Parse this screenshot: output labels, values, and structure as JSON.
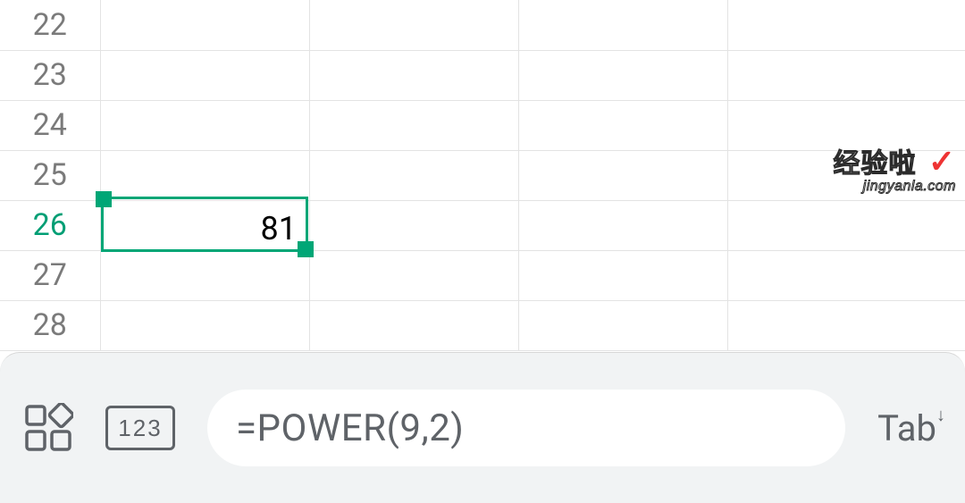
{
  "rows": [
    {
      "n": "22",
      "active": false
    },
    {
      "n": "23",
      "active": false
    },
    {
      "n": "24",
      "active": false
    },
    {
      "n": "25",
      "active": false
    },
    {
      "n": "26",
      "active": true
    },
    {
      "n": "27",
      "active": false
    },
    {
      "n": "28",
      "active": false
    }
  ],
  "activeCell": {
    "displayValue": "81"
  },
  "editor": {
    "numpadLabel": "123",
    "formula": "=POWER(9,2)",
    "tabLabel": "Tab"
  },
  "watermark": {
    "main": "经验啦",
    "check": "✓",
    "sub": "jingyanla.com"
  }
}
